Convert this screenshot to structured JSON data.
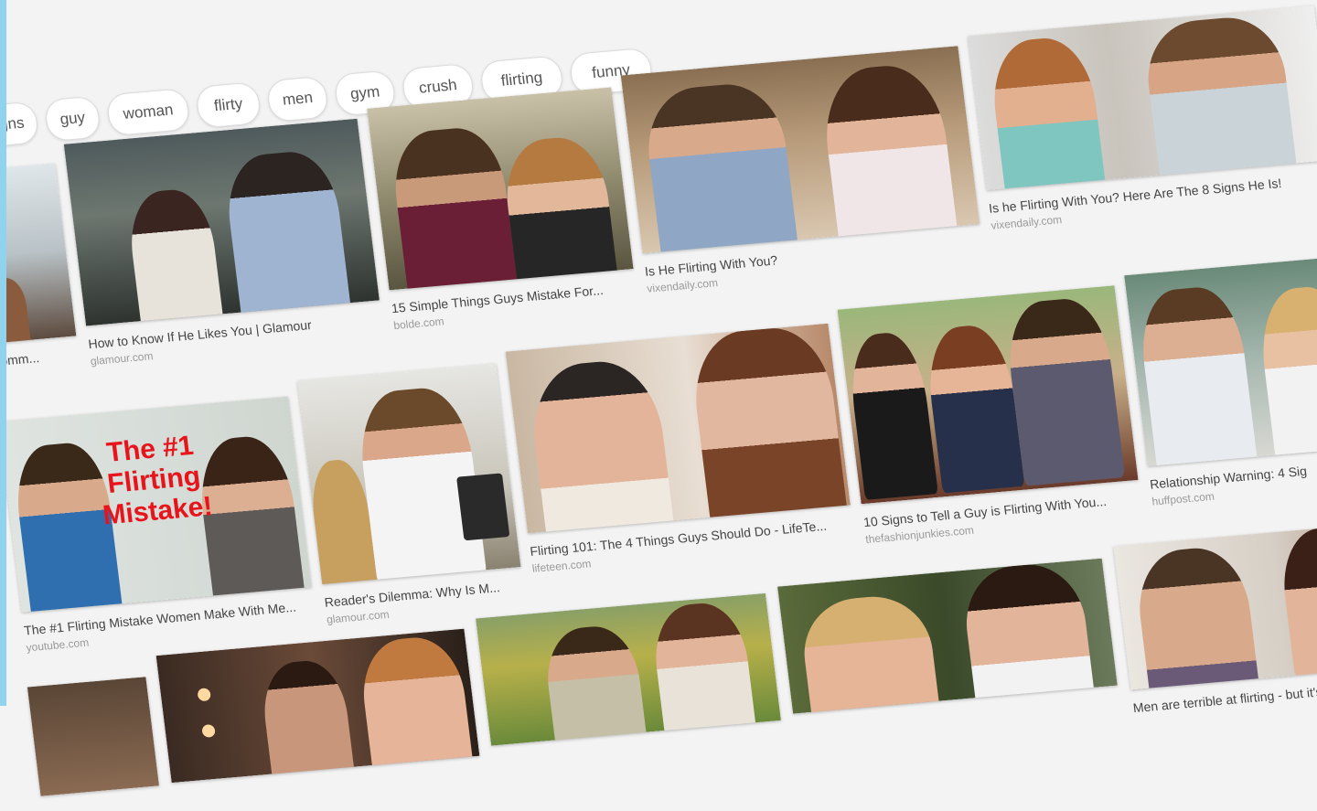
{
  "chips": [
    "signs",
    "guy",
    "woman",
    "flirty",
    "men",
    "gym",
    "crush",
    "flirting",
    "funny"
  ],
  "results": [
    {
      "caption": "is Comm...",
      "source": ""
    },
    {
      "caption": "How to Know If He Likes You | Glamour",
      "source": "glamour.com"
    },
    {
      "caption": "15 Simple Things Guys Mistake For...",
      "source": "bolde.com"
    },
    {
      "caption": "Is He Flirting With You?",
      "source": "vixendaily.com"
    },
    {
      "caption": "Is he Flirting With You? Here Are The 8 Signs He Is!",
      "source": "vixendaily.com"
    },
    {
      "caption": "The #1 Flirting Mistake Women Make With Me...",
      "source": "youtube.com",
      "overlay": [
        "The #1",
        "Flirting",
        "Mistake!"
      ]
    },
    {
      "caption": "Reader's Dilemma: Why Is M...",
      "source": "glamour.com"
    },
    {
      "caption": "Flirting 101: The 4 Things Guys Should Do - LifeTe...",
      "source": "lifeteen.com"
    },
    {
      "caption": "10 Signs to Tell a Guy is Flirting With You...",
      "source": "thefashionjunkies.com"
    },
    {
      "caption": "Relationship Warning: 4 Sig",
      "source": "huffpost.com"
    },
    {
      "caption": "",
      "source": ""
    },
    {
      "caption": "",
      "source": ""
    },
    {
      "caption": "",
      "source": ""
    },
    {
      "caption": "",
      "source": ""
    },
    {
      "caption": "Men are terrible at flirting - but it's",
      "source": ""
    }
  ]
}
